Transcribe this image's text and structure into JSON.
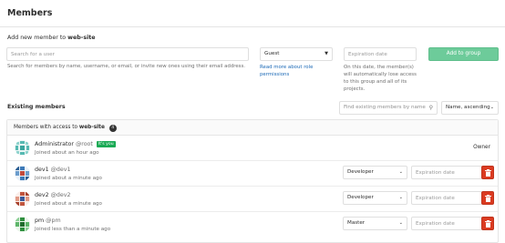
{
  "page": {
    "title": "Members"
  },
  "add_member": {
    "label_prefix": "Add new member to",
    "group_name": "web-site",
    "search_placeholder": "Search for a user",
    "search_help": "Search for members by name, username, or email, or invite new ones using their email address.",
    "role_value": "Guest",
    "role_help": "Read more about role permissions",
    "expiration_placeholder": "Expiration date",
    "expiration_help": "On this date, the member(s) will automatically lose access to this group and all of its projects.",
    "add_button": "Add to group"
  },
  "existing": {
    "label": "Existing members",
    "find_placeholder": "Find existing members by name",
    "sort_value": "Name, ascending"
  },
  "panel": {
    "header_prefix": "Members with access to",
    "group_name": "web-site",
    "count": "4"
  },
  "members": [
    {
      "name": "Administrator",
      "handle": "@root",
      "badge": "It's you",
      "joined": "Joined about an hour ago",
      "role_label": "Owner"
    },
    {
      "name": "dev1",
      "handle": "@dev1",
      "joined": "Joined about a minute ago",
      "role": "Developer",
      "expiration_placeholder": "Expiration date"
    },
    {
      "name": "dev2",
      "handle": "@dev2",
      "joined": "Joined about a minute ago",
      "role": "Developer",
      "expiration_placeholder": "Expiration date"
    },
    {
      "name": "pm",
      "handle": "@pm",
      "joined": "Joined less than a minute ago",
      "role": "Master",
      "expiration_placeholder": "Expiration date"
    }
  ],
  "colors": {
    "add_button": "#6dcb9a",
    "delete_button": "#db3b21",
    "badge": "#1aaa55",
    "link": "#1b69b6"
  }
}
